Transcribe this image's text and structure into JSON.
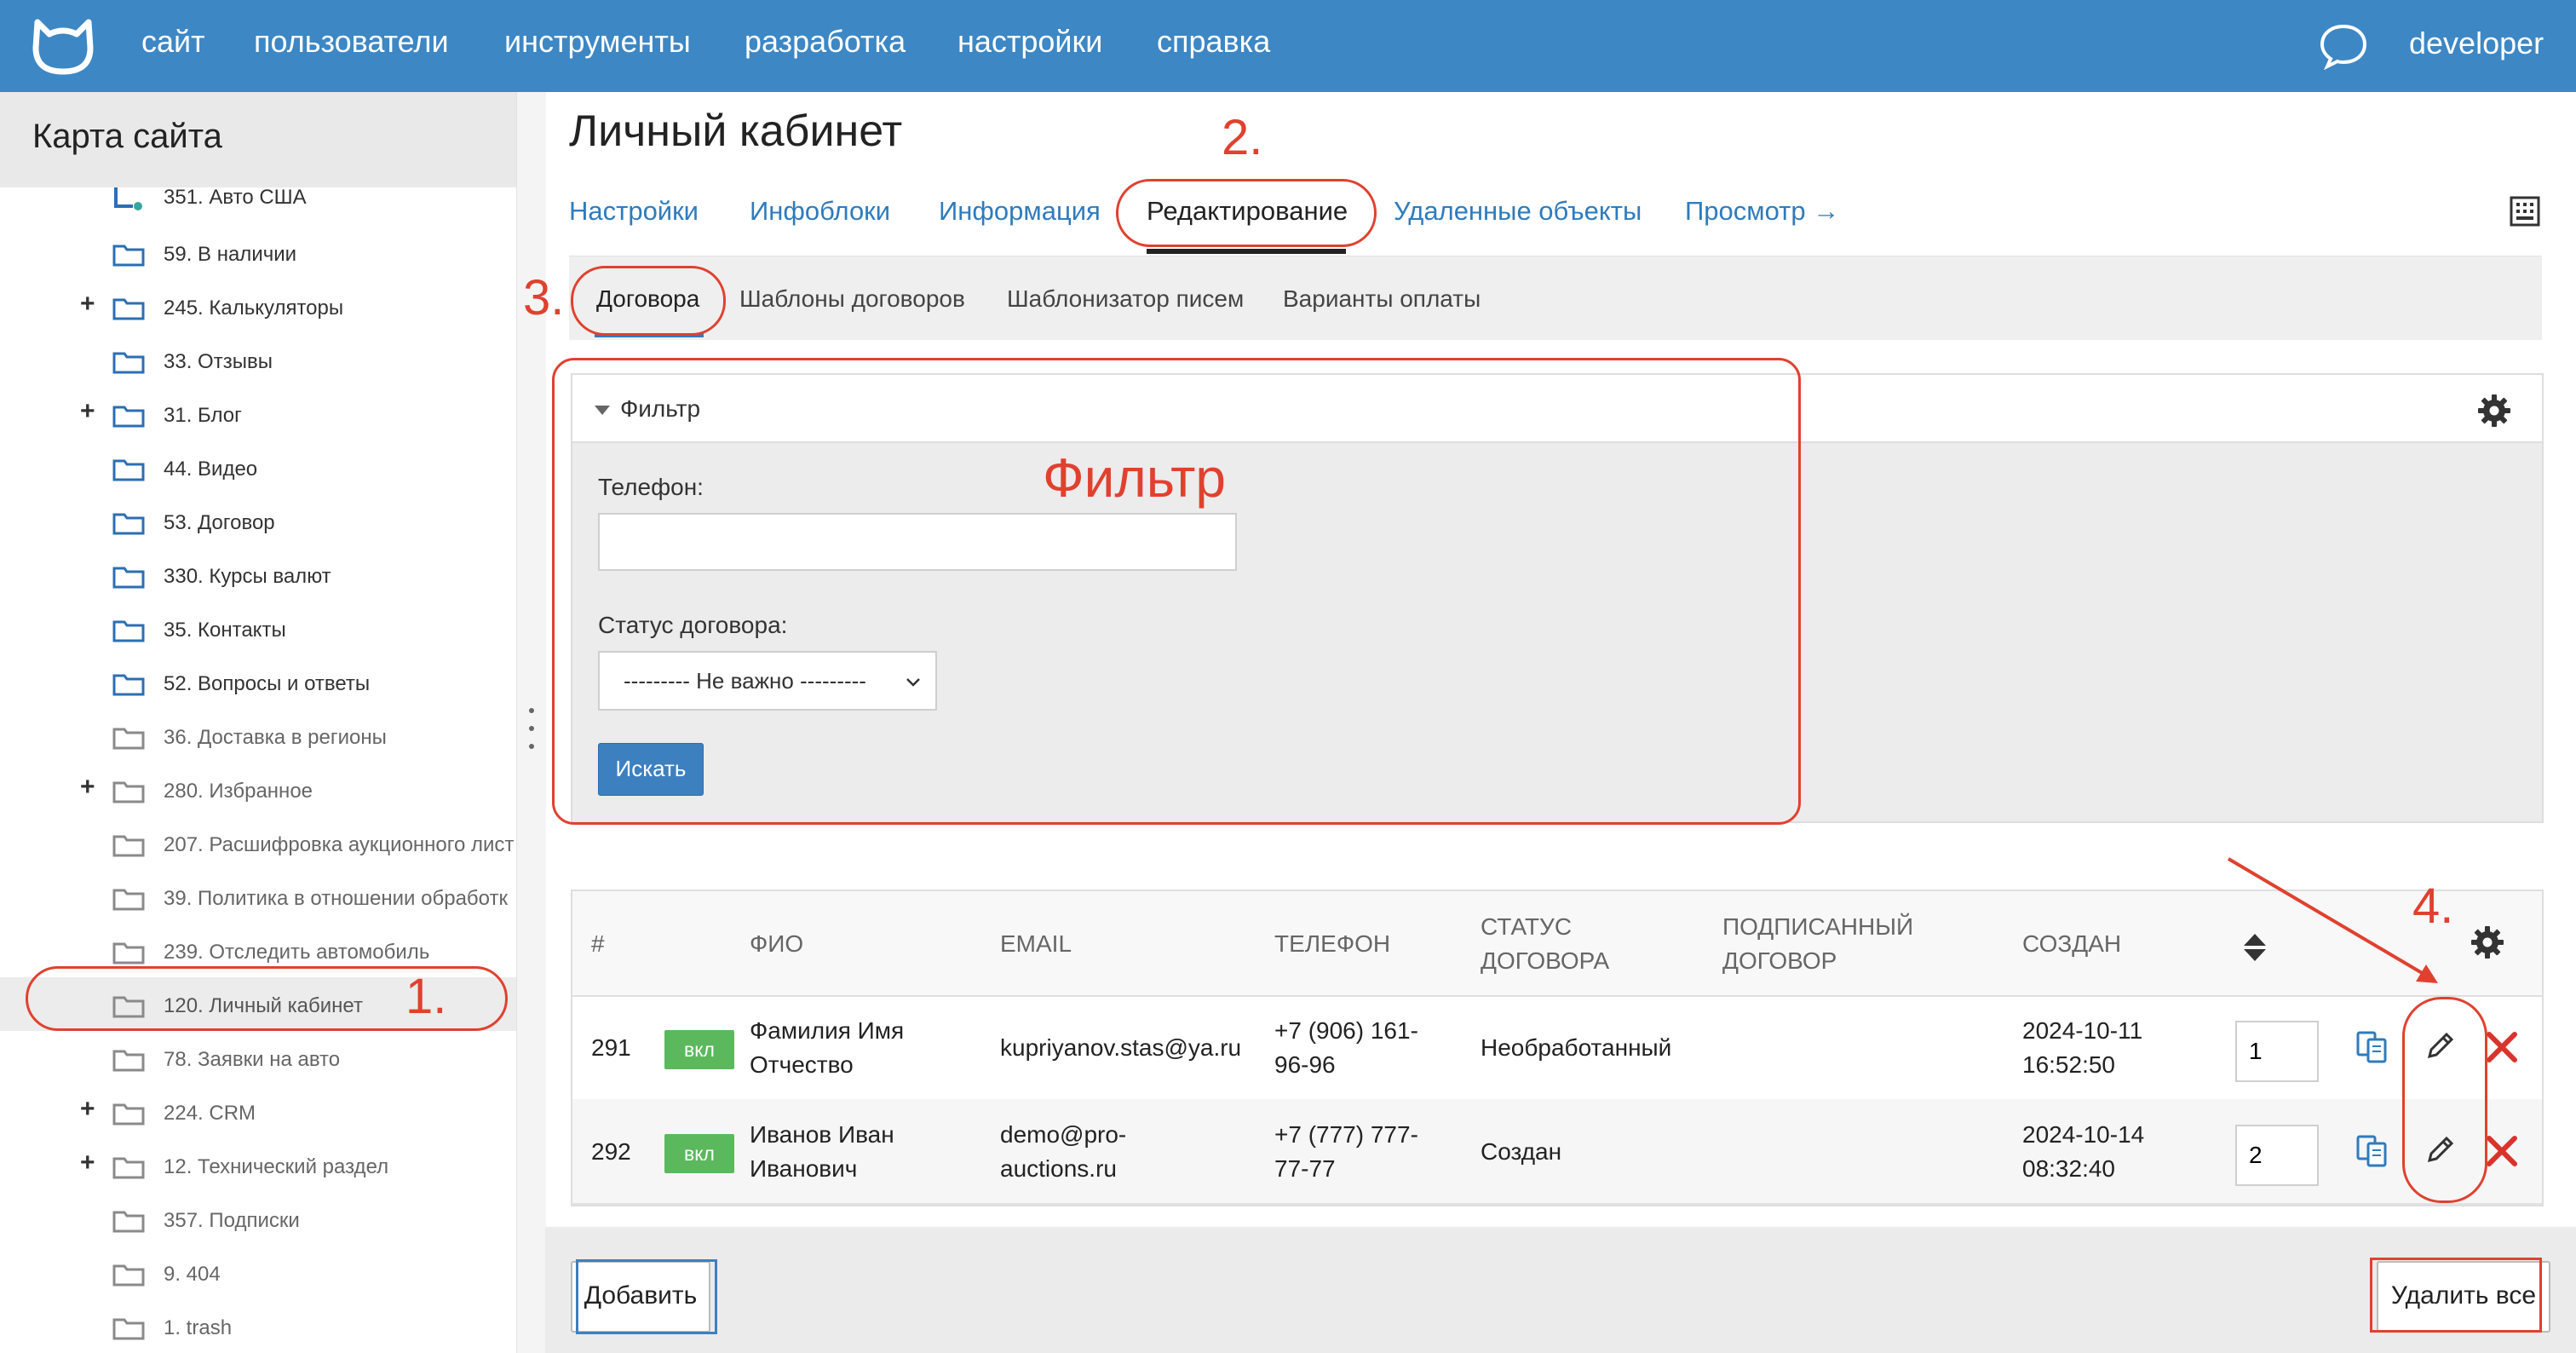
{
  "topbar": {
    "logo_icon": "cat-head-logo-icon",
    "menu": [
      "сайт",
      "пользователи",
      "инструменты",
      "разработка",
      "настройки",
      "справка"
    ],
    "chat_icon": "speech-bubble-icon",
    "user": "developer"
  },
  "sidebar": {
    "title": "Карта сайта",
    "items": [
      {
        "label": "351. Авто США",
        "expand": "",
        "icon": "tree-branch-icon"
      },
      {
        "label": "59. В наличии",
        "expand": "",
        "icon": "folder-icon"
      },
      {
        "label": "245. Калькуляторы",
        "expand": "+",
        "icon": "folder-icon"
      },
      {
        "label": "33. Отзывы",
        "expand": "",
        "icon": "folder-icon"
      },
      {
        "label": "31. Блог",
        "expand": "+",
        "icon": "folder-icon"
      },
      {
        "label": "44. Видео",
        "expand": "",
        "icon": "folder-icon"
      },
      {
        "label": "53. Договор",
        "expand": "",
        "icon": "folder-icon"
      },
      {
        "label": "330. Курсы валют",
        "expand": "",
        "icon": "folder-icon"
      },
      {
        "label": "35. Контакты",
        "expand": "",
        "icon": "folder-icon"
      },
      {
        "label": "52. Вопросы и ответы",
        "expand": "",
        "icon": "folder-icon"
      },
      {
        "label": "36. Доставка в регионы",
        "expand": "",
        "icon": "folder-icon"
      },
      {
        "label": "280. Избранное",
        "expand": "+",
        "icon": "folder-icon"
      },
      {
        "label": "207. Расшифровка аукционного лист",
        "expand": "",
        "icon": "folder-icon"
      },
      {
        "label": "39. Политика в отношении обработк",
        "expand": "",
        "icon": "folder-icon"
      },
      {
        "label": "239. Отследить автомобиль",
        "expand": "",
        "icon": "folder-icon"
      },
      {
        "label": "120. Личный кабинет",
        "expand": "",
        "icon": "folder-icon"
      },
      {
        "label": "78. Заявки на авто",
        "expand": "",
        "icon": "folder-icon"
      },
      {
        "label": "224. CRM",
        "expand": "+",
        "icon": "folder-icon"
      },
      {
        "label": "12. Технический раздел",
        "expand": "+",
        "icon": "folder-icon"
      },
      {
        "label": "357. Подписки",
        "expand": "",
        "icon": "folder-icon"
      },
      {
        "label": "9. 404",
        "expand": "",
        "icon": "folder-icon"
      },
      {
        "label": "1. trash",
        "expand": "",
        "icon": "folder-icon"
      }
    ]
  },
  "main": {
    "title": "Личный кабинет",
    "tabs": [
      "Настройки",
      "Инфоблоки",
      "Информация",
      "Редактирование",
      "Удаленные объекты",
      "Просмотр →"
    ],
    "active_tab": "Редактирование",
    "subtabs": [
      "Договора",
      "Шаблоны договоров",
      "Шаблонизатор писем",
      "Варианты оплаты"
    ],
    "active_subtab": "Договора"
  },
  "filter": {
    "title": "Фильтр",
    "phone_label": "Телефон:",
    "phone_value": "",
    "status_label": "Статус договора:",
    "status_value": "--------- Не важно ---------",
    "search_button": "Искать"
  },
  "table": {
    "headers": {
      "id": "#",
      "fio": "ФИО",
      "email": "EMAIL",
      "phone": "ТЕЛЕФОН",
      "status_1": "СТАТУС",
      "status_2": "ДОГОВОРА",
      "signed_1": "ПОДПИСАННЫЙ",
      "signed_2": "ДОГОВОР",
      "created": "СОЗДАН"
    },
    "rows": [
      {
        "id": "291",
        "badge": "вкл",
        "fio_1": "Фамилия Имя",
        "fio_2": "Отчество",
        "email_1": "kupriyanov.stas@ya.ru",
        "email_2": "",
        "phone_1": "+7 (906) 161-",
        "phone_2": "96-96",
        "status": "Необработанный",
        "signed": "",
        "created_1": "2024-10-11",
        "created_2": "16:52:50",
        "priority": "1"
      },
      {
        "id": "292",
        "badge": "вкл",
        "fio_1": "Иванов Иван",
        "fio_2": "Иванович",
        "email_1": "demo@pro-",
        "email_2": "auctions.ru",
        "phone_1": "+7 (777) 777-",
        "phone_2": "77-77",
        "status": "Создан",
        "signed": "",
        "created_1": "2024-10-14",
        "created_2": "08:32:40",
        "priority": "2"
      }
    ]
  },
  "bottom": {
    "add_button": "Добавить",
    "delete_all_button": "Удалить все"
  },
  "annotations": {
    "n1": "1.",
    "n2": "2.",
    "n3": "3.",
    "n4": "4.",
    "filter_label": "Фильтр",
    "color": "#e0412f"
  },
  "colors": {
    "topbar": "#3d87c4",
    "link": "#2f7bbd",
    "badge": "#5cb85c",
    "delete": "#d9342b"
  }
}
